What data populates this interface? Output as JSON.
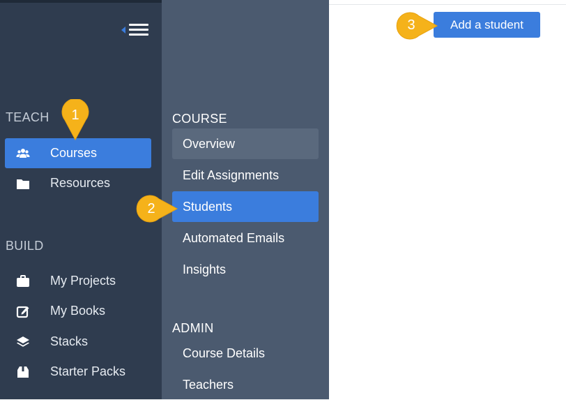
{
  "sidebar": {
    "teach_heading": "TEACH",
    "build_heading": "BUILD",
    "teach_items": [
      {
        "label": "Courses",
        "icon": "users-icon"
      },
      {
        "label": "Resources",
        "icon": "folder-icon"
      }
    ],
    "build_items": [
      {
        "label": "My Projects",
        "icon": "briefcase-icon"
      },
      {
        "label": "My Books",
        "icon": "edit-icon"
      },
      {
        "label": "Stacks",
        "icon": "layers-icon"
      },
      {
        "label": "Starter Packs",
        "icon": "package-icon"
      }
    ]
  },
  "subnav": {
    "course_heading": "COURSE",
    "admin_heading": "ADMIN",
    "course_items": [
      "Overview",
      "Edit Assignments",
      "Students",
      "Automated Emails",
      "Insights"
    ],
    "admin_items": [
      "Course Details",
      "Teachers"
    ]
  },
  "main": {
    "add_student_label": "Add a student"
  },
  "callouts": [
    "1",
    "2",
    "3"
  ],
  "colors": {
    "sidebar_bg": "#2f3c4f",
    "subnav_bg": "#4b5a6f",
    "accent": "#3b7ddd",
    "callout": "#f5b21a"
  }
}
